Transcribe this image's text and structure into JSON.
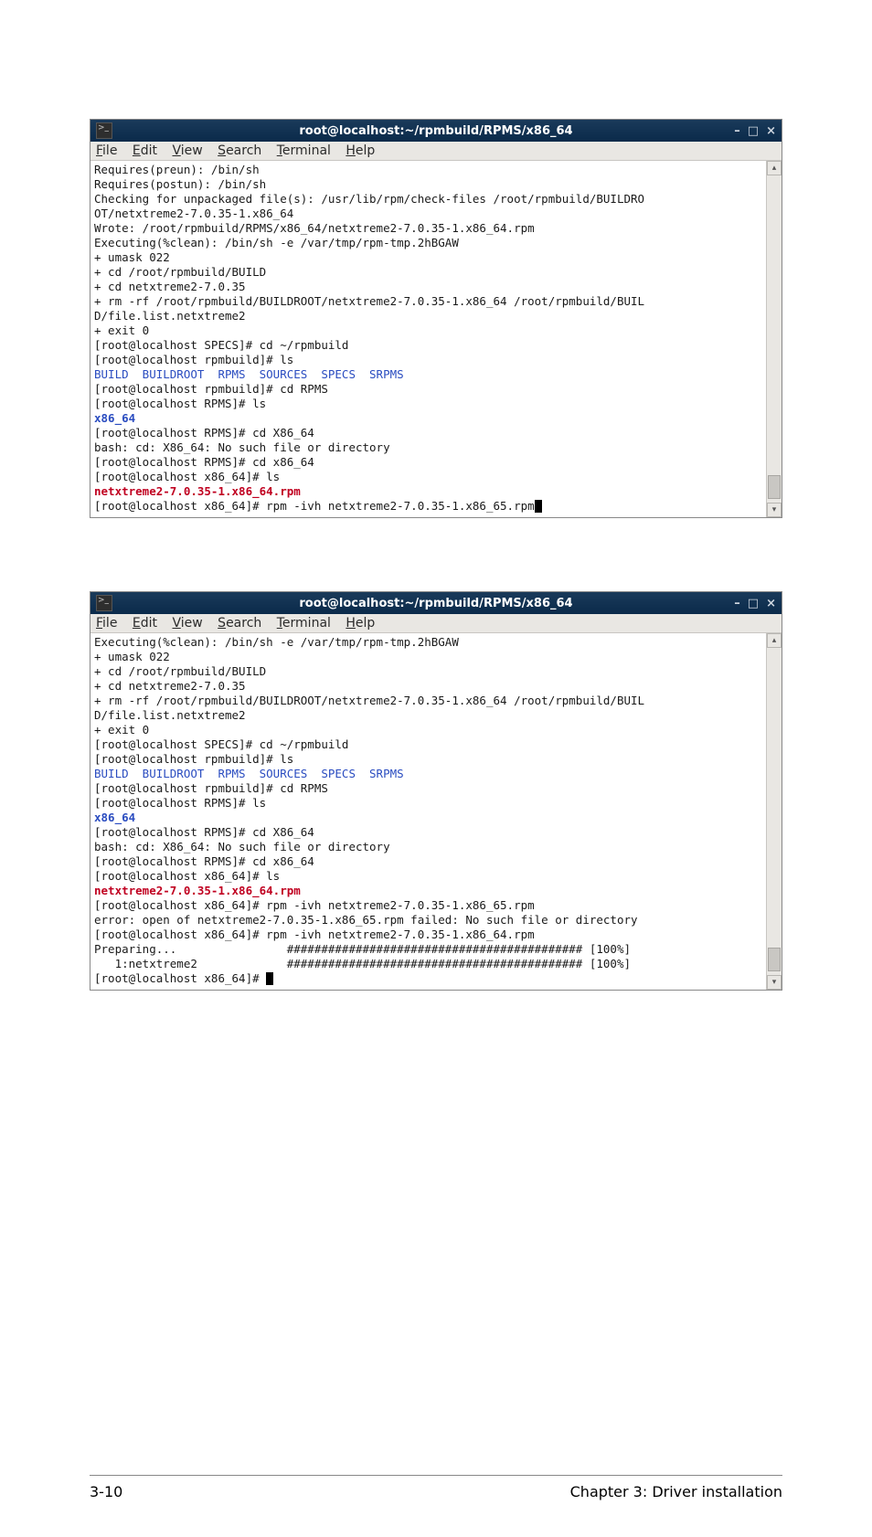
{
  "window1": {
    "title": "root@localhost:~/rpmbuild/RPMS/x86_64",
    "controls": {
      "min": "–",
      "max": "□",
      "close": "×"
    },
    "scrollbar": {
      "up": "▴",
      "down": "▾"
    }
  },
  "window2": {
    "title": "root@localhost:~/rpmbuild/RPMS/x86_64",
    "controls": {
      "min": "–",
      "max": "□",
      "close": "×"
    },
    "scrollbar": {
      "up": "▴",
      "down": "▾"
    }
  },
  "menu": {
    "file": "File",
    "edit": "Edit",
    "view": "View",
    "search": "Search",
    "terminal": "Terminal",
    "help": "Help"
  },
  "term1": {
    "l01": "Requires(preun): /bin/sh",
    "l02": "Requires(postun): /bin/sh",
    "l03": "Checking for unpackaged file(s): /usr/lib/rpm/check-files /root/rpmbuild/BUILDRO",
    "l04": "OT/netxtreme2-7.0.35-1.x86_64",
    "l05": "Wrote: /root/rpmbuild/RPMS/x86_64/netxtreme2-7.0.35-1.x86_64.rpm",
    "l06": "Executing(%clean): /bin/sh -e /var/tmp/rpm-tmp.2hBGAW",
    "l07": "+ umask 022",
    "l08": "+ cd /root/rpmbuild/BUILD",
    "l09": "+ cd netxtreme2-7.0.35",
    "l10": "+ rm -rf /root/rpmbuild/BUILDROOT/netxtreme2-7.0.35-1.x86_64 /root/rpmbuild/BUIL",
    "l11": "D/file.list.netxtreme2",
    "l12": "+ exit 0",
    "l13": "[root@localhost SPECS]# cd ~/rpmbuild",
    "l14": "[root@localhost rpmbuild]# ls",
    "l15": "BUILD  BUILDROOT  RPMS  SOURCES  SPECS  SRPMS",
    "l16": "[root@localhost rpmbuild]# cd RPMS",
    "l17": "[root@localhost RPMS]# ls",
    "l18": "x86_64",
    "l19": "[root@localhost RPMS]# cd X86_64",
    "l20": "bash: cd: X86_64: No such file or directory",
    "l21": "[root@localhost RPMS]# cd x86_64",
    "l22": "[root@localhost x86_64]# ls",
    "l23": "netxtreme2-7.0.35-1.x86_64.rpm",
    "l24": "[root@localhost x86_64]# rpm -ivh netxtreme2-7.0.35-1.x86_65.rpm"
  },
  "term2": {
    "l01": "Executing(%clean): /bin/sh -e /var/tmp/rpm-tmp.2hBGAW",
    "l02": "+ umask 022",
    "l03": "+ cd /root/rpmbuild/BUILD",
    "l04": "+ cd netxtreme2-7.0.35",
    "l05": "+ rm -rf /root/rpmbuild/BUILDROOT/netxtreme2-7.0.35-1.x86_64 /root/rpmbuild/BUIL",
    "l06": "D/file.list.netxtreme2",
    "l07": "+ exit 0",
    "l08": "[root@localhost SPECS]# cd ~/rpmbuild",
    "l09": "[root@localhost rpmbuild]# ls",
    "l10": "BUILD  BUILDROOT  RPMS  SOURCES  SPECS  SRPMS",
    "l11": "[root@localhost rpmbuild]# cd RPMS",
    "l12": "[root@localhost RPMS]# ls",
    "l13": "x86_64",
    "l14": "[root@localhost RPMS]# cd X86_64",
    "l15": "bash: cd: X86_64: No such file or directory",
    "l16": "[root@localhost RPMS]# cd x86_64",
    "l17": "[root@localhost x86_64]# ls",
    "l18": "netxtreme2-7.0.35-1.x86_64.rpm",
    "l19": "[root@localhost x86_64]# rpm -ivh netxtreme2-7.0.35-1.x86_65.rpm",
    "l20": "error: open of netxtreme2-7.0.35-1.x86_65.rpm failed: No such file or directory",
    "l21": "[root@localhost x86_64]# rpm -ivh netxtreme2-7.0.35-1.x86_64.rpm",
    "l22": "Preparing...                ########################################### [100%]",
    "l23": "   1:netxtreme2             ########################################### [100%]",
    "l24": "[root@localhost x86_64]# "
  },
  "footer": {
    "left": "3-10",
    "right": "Chapter 3: Driver installation"
  }
}
